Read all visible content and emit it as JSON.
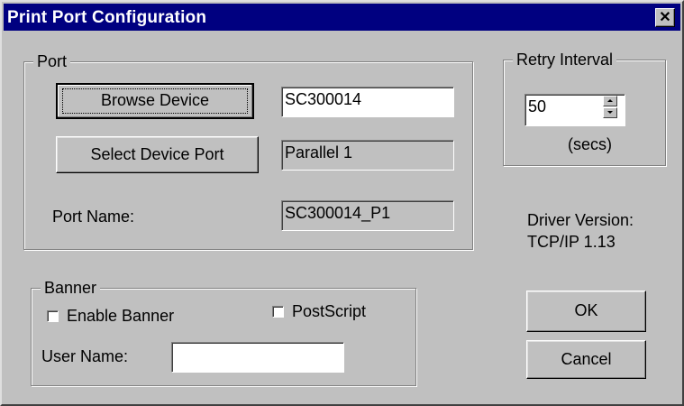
{
  "window": {
    "title": "Print Port Configuration",
    "close_symbol": "✕"
  },
  "port_group": {
    "label": "Port",
    "browse_button": "Browse Device",
    "device_value": "SC300014",
    "select_port_button": "Select Device Port",
    "port_value": "Parallel 1",
    "port_name_label": "Port Name:",
    "port_name_value": "SC300014_P1"
  },
  "retry_group": {
    "label": "Retry Interval",
    "value": "50",
    "unit": "(secs)"
  },
  "driver": {
    "label": "Driver Version:",
    "version": "TCP/IP  1.13"
  },
  "banner_group": {
    "label": "Banner",
    "enable_banner_label": "Enable Banner",
    "enable_banner_checked": false,
    "postscript_label": "PostScript",
    "postscript_checked": false,
    "user_name_label": "User Name:",
    "user_name_value": ""
  },
  "buttons": {
    "ok": "OK",
    "cancel": "Cancel"
  },
  "colors": {
    "titlebar": "#000080",
    "face": "#c0c0c0"
  }
}
